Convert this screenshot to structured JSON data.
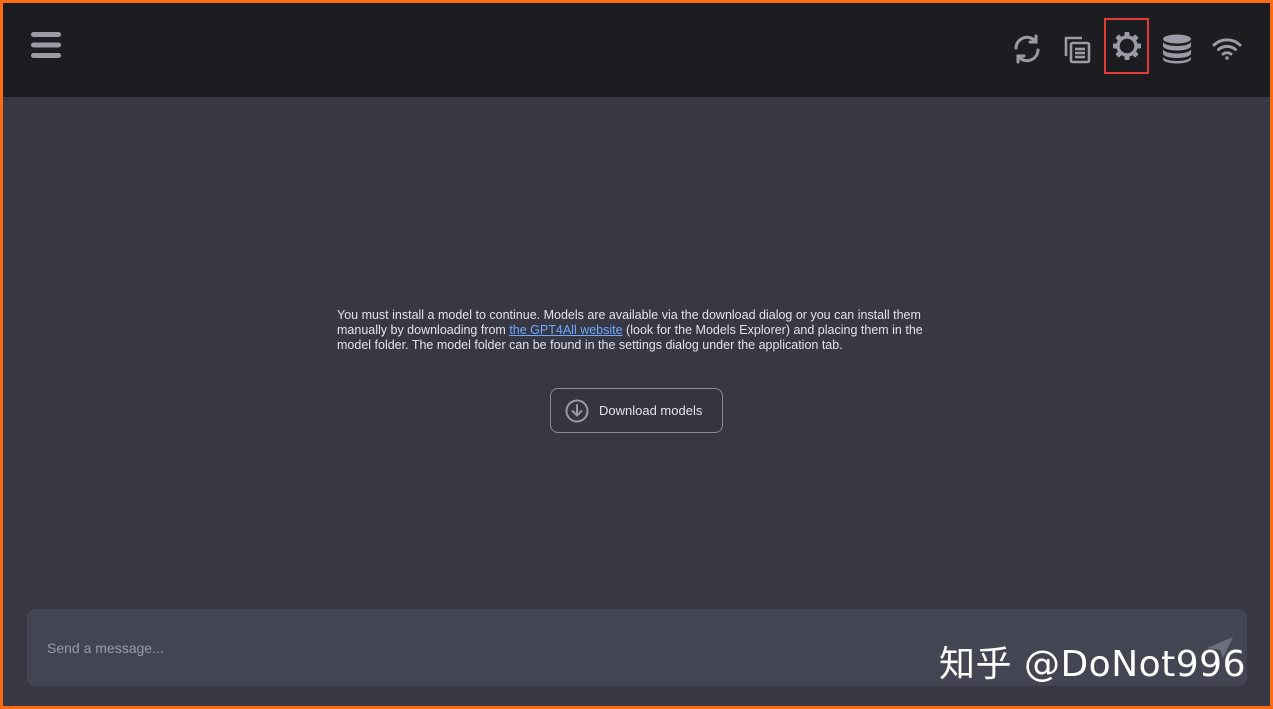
{
  "notice": {
    "before_link": "You must install a model to continue. Models are available via the download dialog or you can install them manually by downloading from ",
    "link_text": "the GPT4All website",
    "after_link": " (look for the Models Explorer) and placing them in the model folder. The model folder can be found in the settings dialog under the application tab."
  },
  "download_button": {
    "label": "Download models"
  },
  "composer": {
    "placeholder": "Send a message..."
  },
  "watermark": {
    "text": "知乎 @DoNot996"
  },
  "icons": {
    "menu": "hamburger-icon",
    "reload": "reload-icon",
    "copy": "copy-icon",
    "settings": "gear-icon",
    "database": "database-icon",
    "network": "wifi-icon",
    "download": "download-circle-icon",
    "send": "send-icon"
  },
  "colors": {
    "topbar": "#1c1d21",
    "background": "#373843",
    "composer": "#444553",
    "icon": "#9a9ba6",
    "highlight": "#e23b35",
    "link": "#6ea8ff",
    "frame": "#ff6a14"
  }
}
